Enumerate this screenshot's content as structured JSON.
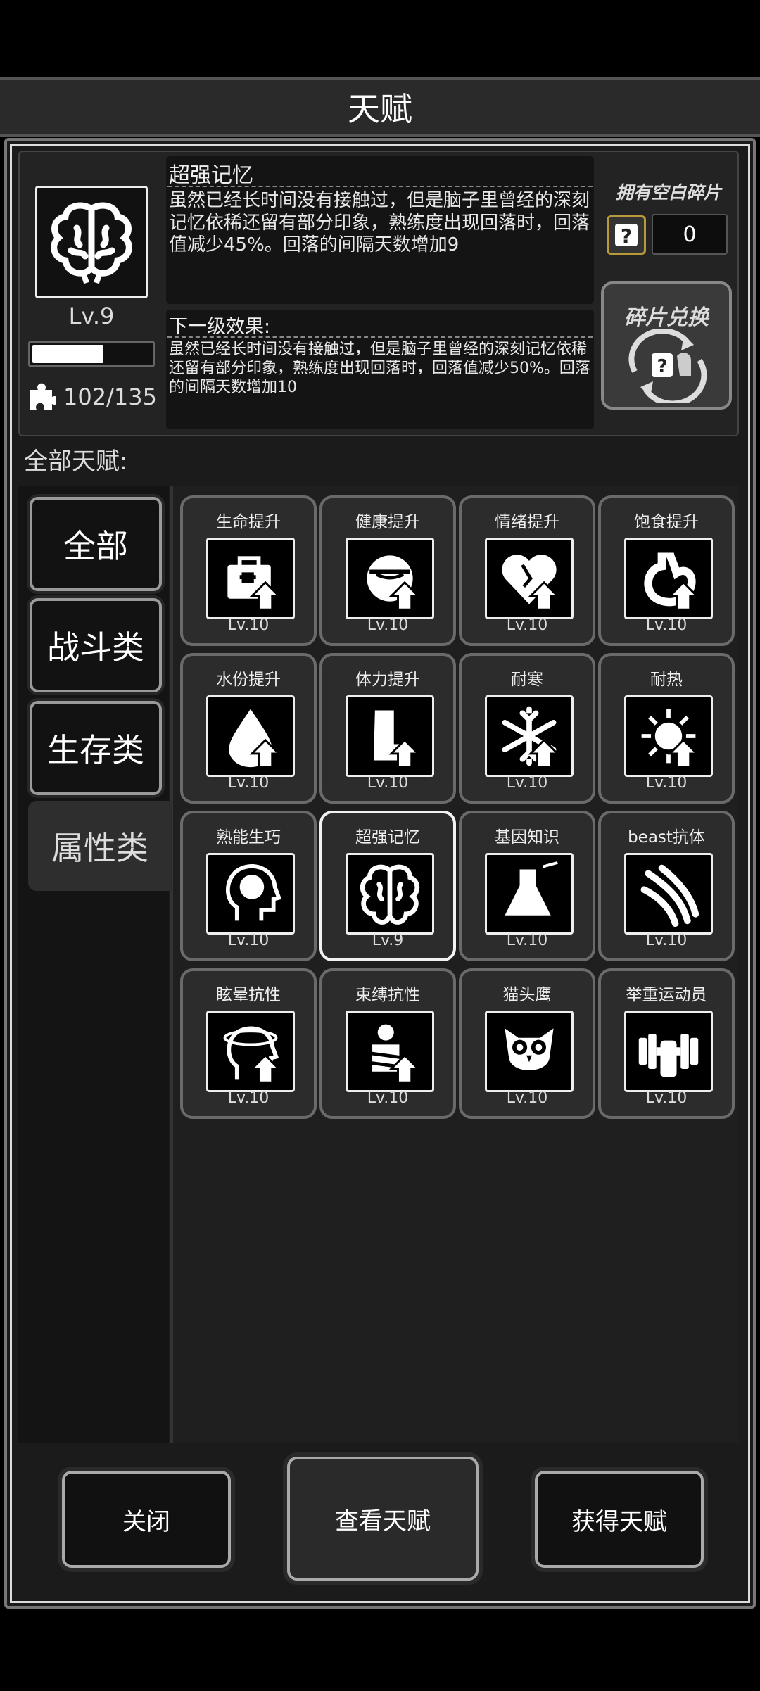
{
  "window_title": "天赋",
  "selected_skill": {
    "name": "超强记忆",
    "icon": "brain-icon",
    "level": "Lv.9",
    "xp_fraction": 0.6,
    "description": "虽然已经长时间没有接触过，但是脑子里曾经的深刻记忆依稀还留有部分印象，熟练度出现回落时，回落值减少45%。回落的间隔天数增加9",
    "next_level_label": "下一级效果:",
    "next_level_description": "虽然已经长时间没有接触过，但是脑子里曾经的深刻记忆依稀还留有部分印象，熟练度出现回落时，回落值减少50%。回落的间隔天数增加10",
    "fragments": "102/135"
  },
  "blank_fragments": {
    "label": "拥有空白碎片",
    "count": "0"
  },
  "exchange_button": "碎片兑换",
  "all_talents_label": "全部天赋:",
  "categories": [
    "全部",
    "战斗类",
    "生存类",
    "属性类"
  ],
  "selected_category": "属性类",
  "talents": [
    {
      "name": "生命提升",
      "level": "Lv.10",
      "icon": "medkit-up-icon"
    },
    {
      "name": "健康提升",
      "level": "Lv.10",
      "icon": "pill-up-icon"
    },
    {
      "name": "情绪提升",
      "level": "Lv.10",
      "icon": "heart-up-icon"
    },
    {
      "name": "饱食提升",
      "level": "Lv.10",
      "icon": "stomach-up-icon"
    },
    {
      "name": "水份提升",
      "level": "Lv.10",
      "icon": "water-drop-up-icon"
    },
    {
      "name": "体力提升",
      "level": "Lv.10",
      "icon": "leg-up-icon"
    },
    {
      "name": "耐寒",
      "level": "Lv.10",
      "icon": "snowflake-up-icon"
    },
    {
      "name": "耐热",
      "level": "Lv.10",
      "icon": "sun-up-icon"
    },
    {
      "name": "熟能生巧",
      "level": "Lv.10",
      "icon": "head-brain-icon"
    },
    {
      "name": "超强记忆",
      "level": "Lv.9",
      "icon": "brain-icon"
    },
    {
      "name": "基因知识",
      "level": "Lv.10",
      "icon": "flask-icon"
    },
    {
      "name": "beast抗体",
      "level": "Lv.10",
      "icon": "claw-scratch-icon"
    },
    {
      "name": "眩晕抗性",
      "level": "Lv.10",
      "icon": "dizzy-head-icon"
    },
    {
      "name": "束缚抗性",
      "level": "Lv.10",
      "icon": "bound-person-icon"
    },
    {
      "name": "猫头鹰",
      "level": "Lv.10",
      "icon": "owl-icon"
    },
    {
      "name": "举重运动员",
      "level": "Lv.10",
      "icon": "dumbbell-icon"
    }
  ],
  "selected_talent_index": 9,
  "buttons": {
    "close": "关闭",
    "view": "查看天赋",
    "obtain": "获得天赋"
  }
}
